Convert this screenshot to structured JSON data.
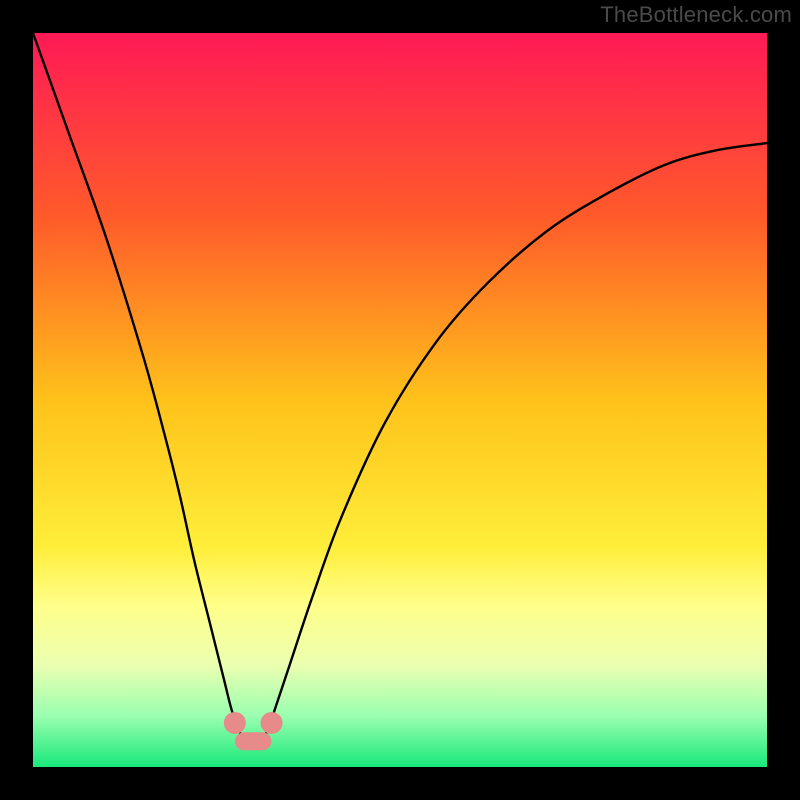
{
  "watermark": "TheBottleneck.com",
  "chart_data": {
    "type": "line",
    "title": "",
    "xlabel": "",
    "ylabel": "",
    "xlim": [
      0,
      100
    ],
    "ylim": [
      0,
      100
    ],
    "gradient_stops": [
      {
        "offset": 0,
        "color": "#ff1a56"
      },
      {
        "offset": 0.25,
        "color": "#ff5a2a"
      },
      {
        "offset": 0.5,
        "color": "#ffc21a"
      },
      {
        "offset": 0.7,
        "color": "#ffee3a"
      },
      {
        "offset": 0.78,
        "color": "#ffff8a"
      },
      {
        "offset": 0.86,
        "color": "#ecffb0"
      },
      {
        "offset": 0.93,
        "color": "#9bffb0"
      },
      {
        "offset": 1.0,
        "color": "#18e87a"
      }
    ],
    "series": [
      {
        "name": "bottleneck-curve",
        "x": [
          0,
          5,
          10,
          15,
          18,
          20,
          22,
          24,
          26,
          27,
          28,
          29,
          30,
          31,
          32,
          33,
          35,
          38,
          42,
          48,
          55,
          62,
          70,
          78,
          86,
          93,
          100
        ],
        "values": [
          100,
          86,
          72,
          56,
          45,
          37,
          28,
          20,
          12,
          8,
          5,
          4,
          4,
          4,
          5,
          8,
          14,
          23,
          34,
          47,
          58,
          66,
          73,
          78,
          82,
          84,
          85
        ]
      }
    ],
    "highlight_points": [
      {
        "x": 27.5,
        "y": 6
      },
      {
        "x": 32.5,
        "y": 6
      }
    ],
    "highlight_band": {
      "x_start": 27.5,
      "x_end": 32.5,
      "y": 3.5
    },
    "highlight_color": "#e68a8a"
  }
}
